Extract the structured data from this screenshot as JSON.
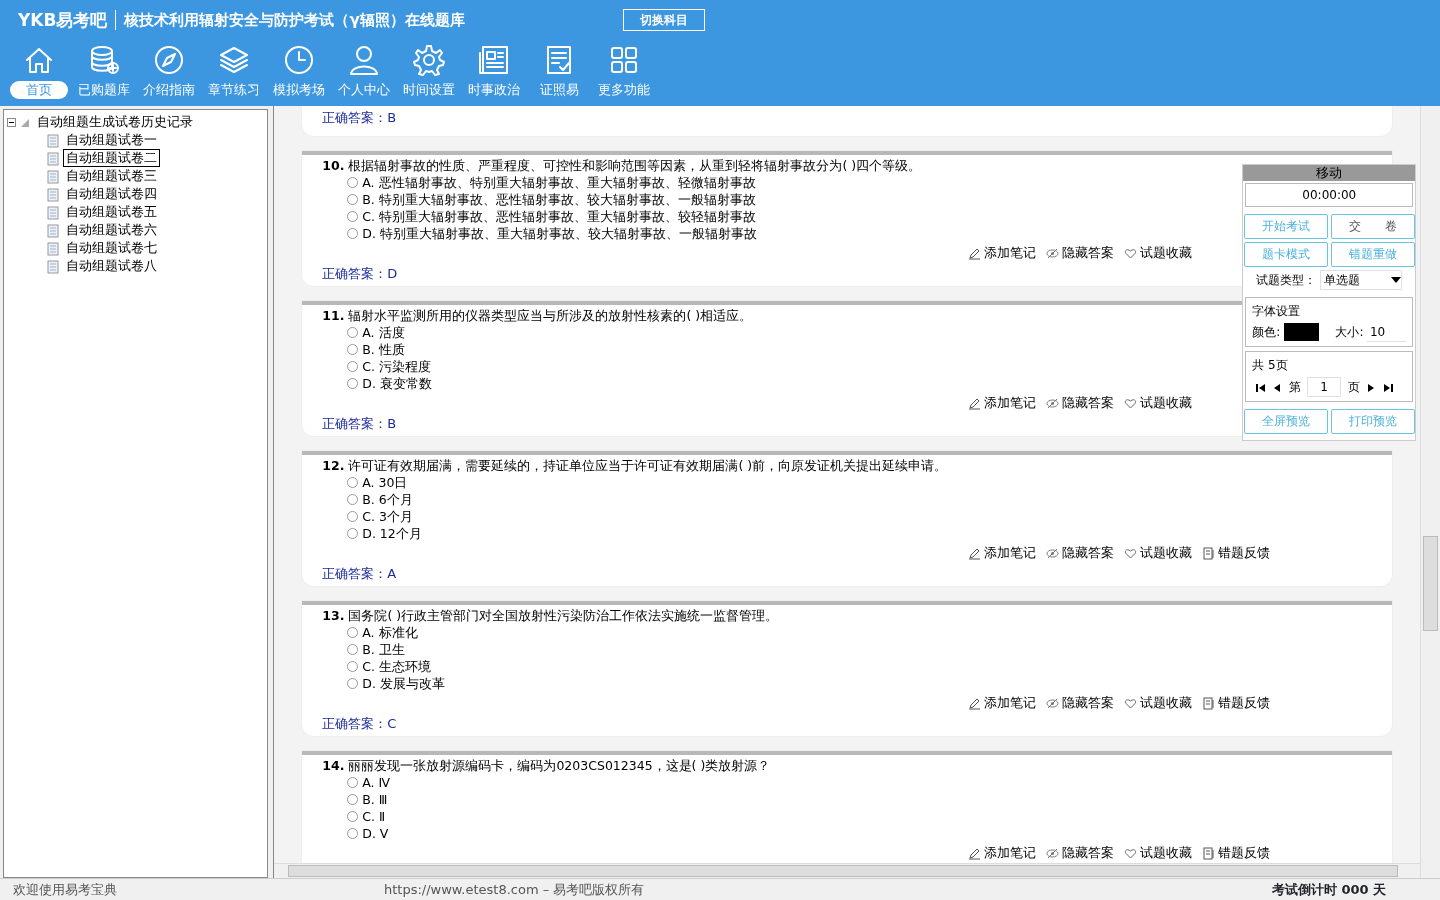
{
  "header": {
    "logo": "YKB易考吧",
    "title": "核技术利用辐射安全与防护考试（γ辐照）在线题库",
    "switch_button": "切换科目"
  },
  "nav": [
    {
      "label": "首页",
      "selected": true
    },
    {
      "label": "已购题库",
      "selected": false
    },
    {
      "label": "介绍指南",
      "selected": false
    },
    {
      "label": "章节练习",
      "selected": false
    },
    {
      "label": "模拟考场",
      "selected": false
    },
    {
      "label": "个人中心",
      "selected": false
    },
    {
      "label": "时间设置",
      "selected": false
    },
    {
      "label": "时事政治",
      "selected": false
    },
    {
      "label": "证照易",
      "selected": false
    },
    {
      "label": "更多功能",
      "selected": false
    }
  ],
  "tree": {
    "label": "自动组题生成试卷历史记录",
    "expanded": true,
    "children": [
      {
        "label": "自动组题试卷一",
        "selected": false
      },
      {
        "label": "自动组题试卷二",
        "selected": true
      },
      {
        "label": "自动组题试卷三",
        "selected": false
      },
      {
        "label": "自动组题试卷四",
        "selected": false
      },
      {
        "label": "自动组题试卷五",
        "selected": false
      },
      {
        "label": "自动组题试卷六",
        "selected": false
      },
      {
        "label": "自动组题试卷七",
        "selected": false
      },
      {
        "label": "自动组题试卷八",
        "selected": false
      }
    ]
  },
  "partial_answer": {
    "label": "正确答案：",
    "value": "B"
  },
  "questions": [
    {
      "number": "10.",
      "text": "根据辐射事故的性质、严重程度、可控性和影响范围等因素，从重到轻将辐射事故分为( )四个等级。",
      "options": [
        {
          "letter": "A.",
          "text": "恶性辐射事故、特别重大辐射事故、重大辐射事故、轻微辐射事故",
          "selected": false
        },
        {
          "letter": "B.",
          "text": "特别重大辐射事故、恶性辐射事故、较大辐射事故、一般辐射事故",
          "selected": false
        },
        {
          "letter": "C.",
          "text": "特别重大辐射事故、恶性辐射事故、重大辐射事故、较轻辐射事故",
          "selected": false
        },
        {
          "letter": "D.",
          "text": "特别重大辐射事故、重大辐射事故、较大辐射事故、一般辐射事故",
          "selected": false
        }
      ],
      "actions": [
        "添加笔记",
        "隐藏答案",
        "试题收藏"
      ],
      "answer_label": "正确答案：",
      "answer": "D"
    },
    {
      "number": "11.",
      "text": "辐射水平监测所用的仪器类型应当与所涉及的放射性核素的( )相适应。",
      "options": [
        {
          "letter": "A.",
          "text": "活度",
          "selected": false
        },
        {
          "letter": "B.",
          "text": "性质",
          "selected": false
        },
        {
          "letter": "C.",
          "text": "污染程度",
          "selected": false
        },
        {
          "letter": "D.",
          "text": "衰变常数",
          "selected": false
        }
      ],
      "actions": [
        "添加笔记",
        "隐藏答案",
        "试题收藏"
      ],
      "answer_label": "正确答案：",
      "answer": "B"
    },
    {
      "number": "12.",
      "text": "许可证有效期届满，需要延续的，持证单位应当于许可证有效期届满( )前，向原发证机关提出延续申请。",
      "options": [
        {
          "letter": "A.",
          "text": "30日",
          "selected": false
        },
        {
          "letter": "B.",
          "text": "6个月",
          "selected": false
        },
        {
          "letter": "C.",
          "text": "3个月",
          "selected": false
        },
        {
          "letter": "D.",
          "text": "12个月",
          "selected": false
        }
      ],
      "actions": [
        "添加笔记",
        "隐藏答案",
        "试题收藏",
        "错题反馈"
      ],
      "answer_label": "正确答案：",
      "answer": "A"
    },
    {
      "number": "13.",
      "text": "国务院( )行政主管部门对全国放射性污染防治工作依法实施统一监督管理。",
      "options": [
        {
          "letter": "A.",
          "text": "标准化",
          "selected": false
        },
        {
          "letter": "B.",
          "text": "卫生",
          "selected": false
        },
        {
          "letter": "C.",
          "text": "生态环境",
          "selected": false
        },
        {
          "letter": "D.",
          "text": "发展与改革",
          "selected": false
        }
      ],
      "actions": [
        "添加笔记",
        "隐藏答案",
        "试题收藏",
        "错题反馈"
      ],
      "answer_label": "正确答案：",
      "answer": "C"
    },
    {
      "number": "14.",
      "text": "丽丽发现一张放射源编码卡，编码为0203CS012345，这是( )类放射源？",
      "options": [
        {
          "letter": "A.",
          "text": "Ⅳ",
          "selected": false
        },
        {
          "letter": "B.",
          "text": "Ⅲ",
          "selected": false
        },
        {
          "letter": "C.",
          "text": "Ⅱ",
          "selected": false
        },
        {
          "letter": "D.",
          "text": "Ⅴ",
          "selected": false
        }
      ],
      "actions": [
        "添加笔记",
        "隐藏答案",
        "试题收藏",
        "错题反馈"
      ]
    }
  ],
  "panel": {
    "title": "移动",
    "timer": "00:00:00",
    "buttons": [
      "开始考试",
      "交　　卷",
      "题卡模式",
      "错题重做"
    ],
    "type_label": "试题类型：",
    "type_value": "单选题",
    "font_group": "字体设置",
    "color_label": "颜色:",
    "color": "#000000",
    "size_label": "大小:",
    "size_value": "10",
    "pages_group": "共 5页",
    "page_prefix": "第",
    "page_value": "1",
    "page_suffix": "页",
    "bottom_buttons": [
      "全屏预览",
      "打印预览"
    ]
  },
  "status_bar": {
    "welcome": "欢迎使用易考宝典",
    "copyright": "https://www.etest8.com – 易考吧版权所有",
    "countdown": "考试倒计时 000 天"
  }
}
